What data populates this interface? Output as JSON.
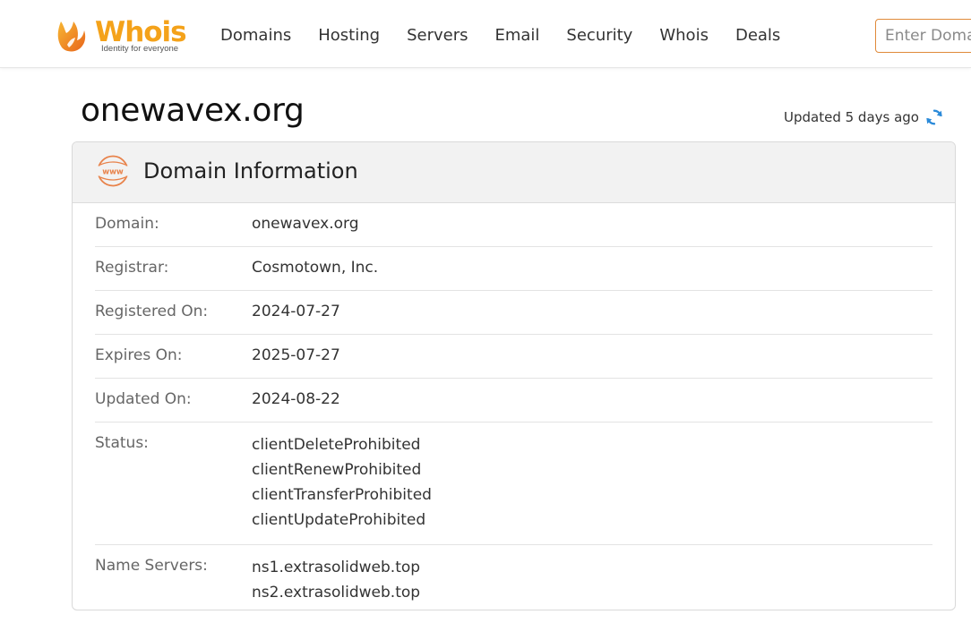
{
  "header": {
    "logo": {
      "word": "Whois",
      "tagline": "Identity for everyone",
      "color": "#f4a21a"
    },
    "nav": [
      {
        "label": "Domains"
      },
      {
        "label": "Hosting"
      },
      {
        "label": "Servers"
      },
      {
        "label": "Email"
      },
      {
        "label": "Security"
      },
      {
        "label": "Whois"
      },
      {
        "label": "Deals"
      }
    ],
    "search": {
      "placeholder": "Enter Domain",
      "value": ""
    }
  },
  "page": {
    "title": "onewavex.org",
    "updated_text": "Updated 5 days ago",
    "refresh_icon": "refresh-icon",
    "accent_color": "#2b8ad9"
  },
  "card": {
    "icon": "www-icon",
    "title": "Domain Information",
    "rows": [
      {
        "label": "Domain:",
        "values": [
          "onewavex.org"
        ]
      },
      {
        "label": "Registrar:",
        "values": [
          "Cosmotown, Inc."
        ]
      },
      {
        "label": "Registered On:",
        "values": [
          "2024-07-27"
        ]
      },
      {
        "label": "Expires On:",
        "values": [
          "2025-07-27"
        ]
      },
      {
        "label": "Updated On:",
        "values": [
          "2024-08-22"
        ]
      },
      {
        "label": "Status:",
        "values": [
          "clientDeleteProhibited",
          "clientRenewProhibited",
          "clientTransferProhibited",
          "clientUpdateProhibited"
        ]
      },
      {
        "label": "Name Servers:",
        "values": [
          "ns1.extrasolidweb.top",
          "ns2.extrasolidweb.top"
        ]
      }
    ]
  }
}
